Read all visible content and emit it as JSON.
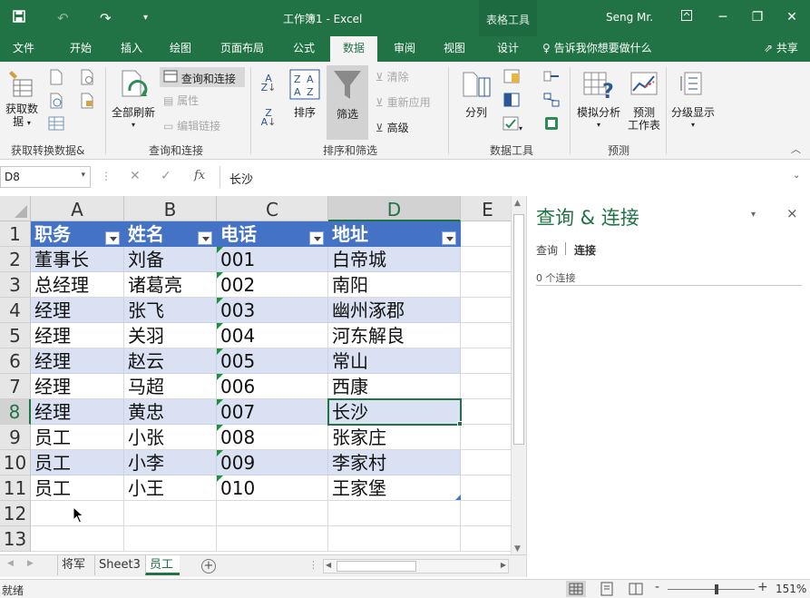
{
  "title_bar": {
    "doc_title": "工作簿1  -  Excel",
    "context_tools": "表格工具",
    "user": "Seng Mr.",
    "icons": [
      "save-icon",
      "undo-icon",
      "redo-icon",
      "customize-qat-icon",
      "ribbon-display-icon",
      "minimize-icon",
      "restore-icon",
      "close-icon"
    ]
  },
  "tabs": [
    {
      "label": "文件",
      "active": false
    },
    {
      "label": "开始",
      "active": false
    },
    {
      "label": "插入",
      "active": false
    },
    {
      "label": "绘图",
      "active": false
    },
    {
      "label": "页面布局",
      "active": false
    },
    {
      "label": "公式",
      "active": false
    },
    {
      "label": "数据",
      "active": true
    },
    {
      "label": "审阅",
      "active": false
    },
    {
      "label": "视图",
      "active": false
    },
    {
      "label": "设计",
      "active": false
    }
  ],
  "tell_me": "告诉我你想要做什么",
  "share": "共享",
  "ribbon": {
    "groups": [
      {
        "label": "获取转换数据&"
      },
      {
        "label": "查询和连接"
      },
      {
        "label": "排序和筛选"
      },
      {
        "label": "数据工具"
      },
      {
        "label": "预测"
      }
    ],
    "get_data_line1": "获取数",
    "get_data_line2": "据",
    "refresh_all": "全部刷新",
    "queries_connections": "查询和连接",
    "properties": "属性",
    "edit_links": "编辑链接",
    "sort": "排序",
    "filter": "筛选",
    "clear": "清除",
    "reapply": "重新应用",
    "advanced": "高级",
    "text_to_columns": "分列",
    "what_if_analysis": "模拟分析",
    "forecast_sheet_line1": "预测",
    "forecast_sheet_line2": "工作表",
    "outline": "分级显示"
  },
  "formula_bar": {
    "name_box": "D8",
    "fx": "fx",
    "value": "长沙"
  },
  "grid": {
    "columns": [
      "A",
      "B",
      "C",
      "D",
      "E"
    ],
    "rows": [
      "1",
      "2",
      "3",
      "4",
      "5",
      "6",
      "7",
      "8",
      "9",
      "10",
      "11",
      "12",
      "13"
    ],
    "selected_cell": "D8",
    "table_header": [
      "职务",
      "姓名",
      "电话",
      "地址"
    ],
    "table_rows": [
      [
        "董事长",
        "刘备",
        "001",
        "白帝城"
      ],
      [
        "总经理",
        "诸葛亮",
        "002",
        "南阳"
      ],
      [
        "经理",
        "张飞",
        "003",
        "幽州涿郡"
      ],
      [
        "经理",
        "关羽",
        "004",
        "河东解良"
      ],
      [
        "经理",
        "赵云",
        "005",
        "常山"
      ],
      [
        "经理",
        "马超",
        "006",
        "西康"
      ],
      [
        "经理",
        "黄忠",
        "007",
        "长沙"
      ],
      [
        "员工",
        "小张",
        "008",
        "张家庄"
      ],
      [
        "员工",
        "小李",
        "009",
        "李家村"
      ],
      [
        "员工",
        "小王",
        "010",
        "王家堡"
      ]
    ],
    "header_color": "#4472c4",
    "band_color": "#d9e1f2"
  },
  "sheets": {
    "tabs": [
      "将军",
      "Sheet3",
      "员工"
    ],
    "active": "员工"
  },
  "status": {
    "text": "就绪",
    "zoom": "151%"
  },
  "pane": {
    "title": "查询 & 连接",
    "tabs": [
      "查询",
      "连接"
    ],
    "active_tab": "连接",
    "count": "0 个连接"
  },
  "colors": {
    "brand": "#217346",
    "table_header": "#4472c4",
    "table_band": "#d9e1f2"
  }
}
